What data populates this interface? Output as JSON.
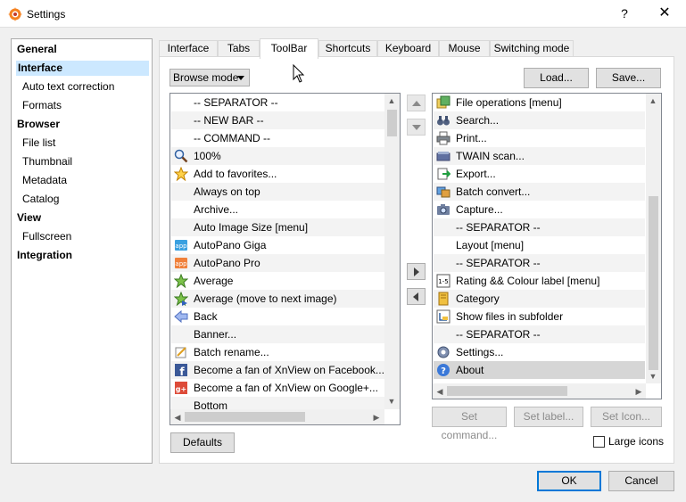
{
  "window": {
    "title": "Settings",
    "help": "?",
    "close": "✕"
  },
  "categories": [
    {
      "label": "General",
      "bold": true,
      "indent": false,
      "selected": false
    },
    {
      "label": "Interface",
      "bold": true,
      "indent": false,
      "selected": true
    },
    {
      "label": "Auto text correction",
      "bold": false,
      "indent": true,
      "selected": false
    },
    {
      "label": "Formats",
      "bold": false,
      "indent": true,
      "selected": false
    },
    {
      "label": "Browser",
      "bold": true,
      "indent": false,
      "selected": false
    },
    {
      "label": "File list",
      "bold": false,
      "indent": true,
      "selected": false
    },
    {
      "label": "Thumbnail",
      "bold": false,
      "indent": true,
      "selected": false
    },
    {
      "label": "Metadata",
      "bold": false,
      "indent": true,
      "selected": false
    },
    {
      "label": "Catalog",
      "bold": false,
      "indent": true,
      "selected": false
    },
    {
      "label": "View",
      "bold": true,
      "indent": false,
      "selected": false
    },
    {
      "label": "Fullscreen",
      "bold": false,
      "indent": true,
      "selected": false
    },
    {
      "label": "Integration",
      "bold": true,
      "indent": false,
      "selected": false
    }
  ],
  "tabs": [
    {
      "label": "Interface",
      "active": false
    },
    {
      "label": "Tabs",
      "active": false
    },
    {
      "label": "ToolBar",
      "active": true
    },
    {
      "label": "Shortcuts",
      "active": false
    },
    {
      "label": "Keyboard",
      "active": false
    },
    {
      "label": "Mouse",
      "active": false
    },
    {
      "label": "Switching mode",
      "active": false
    }
  ],
  "mode_select": {
    "value": "Browse mode"
  },
  "buttons": {
    "load": "Load...",
    "save": "Save...",
    "set_command": "Set command...",
    "set_label": "Set label...",
    "set_icon": "Set Icon...",
    "defaults": "Defaults",
    "ok": "OK",
    "cancel": "Cancel"
  },
  "available_items": [
    {
      "label": "-- SEPARATOR --",
      "icon": "",
      "centered": true
    },
    {
      "label": "-- NEW BAR --",
      "icon": "",
      "centered": true
    },
    {
      "label": "-- COMMAND --",
      "icon": "",
      "centered": true
    },
    {
      "label": "100%",
      "icon": "zoom-icon"
    },
    {
      "label": "Add to favorites...",
      "icon": "star-icon"
    },
    {
      "label": "Always on top",
      "icon": ""
    },
    {
      "label": "Archive...",
      "icon": ""
    },
    {
      "label": "Auto Image Size [menu]",
      "icon": ""
    },
    {
      "label": "AutoPano Giga",
      "icon": "autopano-giga-icon"
    },
    {
      "label": "AutoPano Pro",
      "icon": "autopano-pro-icon"
    },
    {
      "label": "Average",
      "icon": "average-star-icon"
    },
    {
      "label": "Average (move to next image)",
      "icon": "average-next-icon"
    },
    {
      "label": "Back",
      "icon": "back-arrow-icon"
    },
    {
      "label": "Banner...",
      "icon": ""
    },
    {
      "label": "Batch rename...",
      "icon": "batch-rename-icon"
    },
    {
      "label": "Become a fan of XnView on Facebook...",
      "icon": "facebook-icon"
    },
    {
      "label": "Become a fan of XnView on Google+...",
      "icon": "google-plus-icon"
    },
    {
      "label": "Bottom",
      "icon": ""
    }
  ],
  "toolbar_items": [
    {
      "label": "File operations [menu]",
      "icon": "file-operations-icon",
      "selected": false
    },
    {
      "label": "Search...",
      "icon": "binoculars-icon",
      "selected": false
    },
    {
      "label": "Print...",
      "icon": "printer-icon",
      "selected": false
    },
    {
      "label": "TWAIN scan...",
      "icon": "scanner-icon",
      "selected": false
    },
    {
      "label": "Export...",
      "icon": "export-icon",
      "selected": false
    },
    {
      "label": "Batch convert...",
      "icon": "batch-convert-icon",
      "selected": false
    },
    {
      "label": "Capture...",
      "icon": "camera-icon",
      "selected": false
    },
    {
      "label": "-- SEPARATOR --",
      "icon": "",
      "selected": false
    },
    {
      "label": "Layout [menu]",
      "icon": "",
      "selected": false
    },
    {
      "label": "-- SEPARATOR --",
      "icon": "",
      "selected": false
    },
    {
      "label": "Rating && Colour label [menu]",
      "icon": "rating-icon",
      "selected": false
    },
    {
      "label": "Category",
      "icon": "category-icon",
      "selected": false
    },
    {
      "label": "Show files in subfolder",
      "icon": "subfolder-icon",
      "selected": false
    },
    {
      "label": "-- SEPARATOR --",
      "icon": "",
      "selected": false
    },
    {
      "label": "Settings...",
      "icon": "gear-icon",
      "selected": false
    },
    {
      "label": "About",
      "icon": "info-icon",
      "selected": true
    }
  ],
  "large_icons": {
    "label": "Large icons",
    "checked": false
  },
  "colors": {
    "selection": "#cce8ff",
    "default_button_border": "#0078d7",
    "app_icon": "#f58220"
  }
}
